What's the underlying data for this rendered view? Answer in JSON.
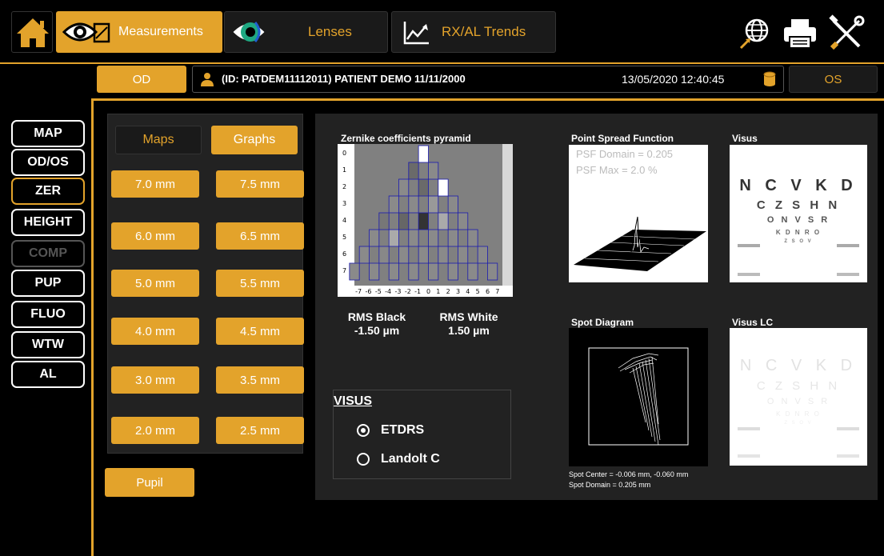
{
  "topbar": {
    "tabs": [
      {
        "label": "Measurements",
        "icon": "eye-measure-icon"
      },
      {
        "label": "Lenses",
        "icon": "lens-eye-icon"
      },
      {
        "label": "RX/AL Trends",
        "icon": "trend-chart-icon"
      }
    ],
    "utilities": [
      "globe-icon",
      "printer-icon",
      "tools-icon"
    ]
  },
  "eyes": {
    "od": "OD",
    "os": "OS"
  },
  "patient": {
    "info": "(ID: PATDEM11112011) PATIENT DEMO 11/11/2000",
    "timestamp": "13/05/2020 12:40:45"
  },
  "side_tabs": [
    "MAP",
    "OD/OS",
    "ZER",
    "HEIGHT",
    "COMP",
    "PUP",
    "FLUO",
    "WTW",
    "AL"
  ],
  "active_side_tab": "ZER",
  "mode_tabs": {
    "maps": "Maps",
    "graphs": "Graphs"
  },
  "diameters": [
    [
      "7.0 mm",
      "7.5 mm"
    ],
    [
      "6.0 mm",
      "6.5 mm"
    ],
    [
      "5.0 mm",
      "5.5 mm"
    ],
    [
      "4.0 mm",
      "4.5 mm"
    ],
    [
      "3.0 mm",
      "3.5 mm"
    ],
    [
      "2.0 mm",
      "2.5 mm"
    ]
  ],
  "pupil_label": "Pupil",
  "zernike": {
    "title": "Zernike coefficients pyramid",
    "y_ticks": [
      "0",
      "1",
      "2",
      "3",
      "4",
      "5",
      "6",
      "7"
    ],
    "x_ticks": [
      "-7",
      "-6",
      "-5",
      "-4",
      "-3",
      "-2",
      "-1",
      "0",
      "1",
      "2",
      "3",
      "4",
      "5",
      "6",
      "7"
    ]
  },
  "rms": {
    "black_label": "RMS Black",
    "black_value": "-1.50 µm",
    "white_label": "RMS White",
    "white_value": "1.50 µm"
  },
  "psf": {
    "title": "Point Spread Function",
    "domain": "PSF Domain = 0.205",
    "max": "PSF Max = 2.0 %"
  },
  "visus": {
    "title": "Visus",
    "rows": [
      "N C V K D",
      "C Z S H N",
      "O N V S R",
      "K D N R O",
      "Z S O V"
    ]
  },
  "spot": {
    "title": "Spot Diagram",
    "center": "Spot Center = -0.006 mm, -0.060 mm",
    "domain": "Spot Domain = 0.205 mm"
  },
  "visus_lc": {
    "title": "Visus LC",
    "rows": [
      "N C V K D",
      "C Z S H N",
      "O N V S R",
      "K D N R O",
      "Z S O V"
    ]
  },
  "visus_options": {
    "title": "VISUS",
    "options": [
      "ETDRS",
      "Landolt C"
    ],
    "selected": "ETDRS"
  }
}
